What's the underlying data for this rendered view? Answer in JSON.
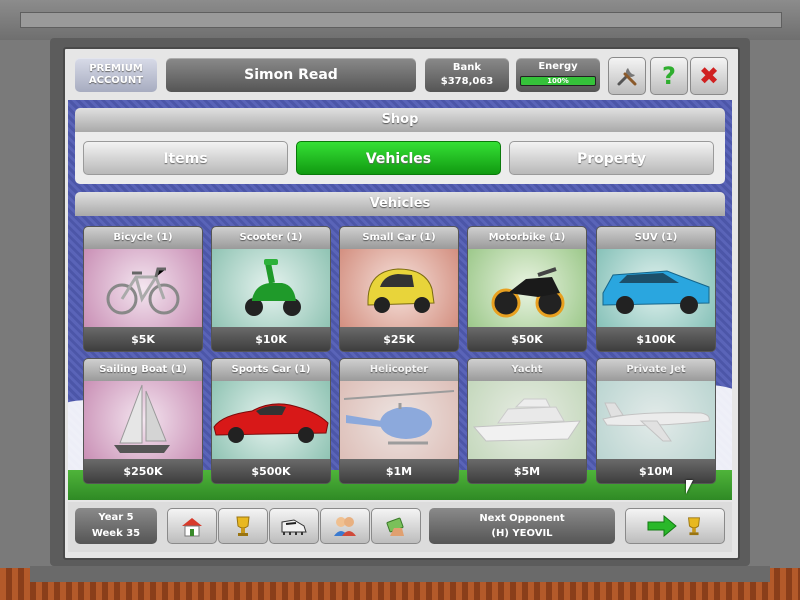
{
  "header": {
    "account_type": "PREMIUM ACCOUNT",
    "manager_name": "Simon Read",
    "bank_label": "Bank",
    "bank_value": "$378,063",
    "energy_label": "Energy",
    "energy_value": "100%",
    "energy_fraction": 1.0
  },
  "shop": {
    "title": "Shop",
    "tabs": [
      {
        "label": "Items",
        "active": false
      },
      {
        "label": "Vehicles",
        "active": true
      },
      {
        "label": "Property",
        "active": false
      }
    ]
  },
  "vehicles": {
    "title": "Vehicles",
    "items": [
      {
        "name": "Bicycle (1)",
        "price": "$5K",
        "owned": true,
        "icon": "bicycle-icon"
      },
      {
        "name": "Scooter (1)",
        "price": "$10K",
        "owned": true,
        "icon": "scooter-icon"
      },
      {
        "name": "Small Car (1)",
        "price": "$25K",
        "owned": true,
        "icon": "small-car-icon"
      },
      {
        "name": "Motorbike (1)",
        "price": "$50K",
        "owned": true,
        "icon": "motorbike-icon"
      },
      {
        "name": "SUV (1)",
        "price": "$100K",
        "owned": true,
        "icon": "suv-icon"
      },
      {
        "name": "Sailing Boat (1)",
        "price": "$250K",
        "owned": true,
        "icon": "sailing-boat-icon"
      },
      {
        "name": "Sports Car (1)",
        "price": "$500K",
        "owned": true,
        "icon": "sports-car-icon"
      },
      {
        "name": "Helicopter",
        "price": "$1M",
        "owned": false,
        "icon": "helicopter-icon"
      },
      {
        "name": "Yacht",
        "price": "$5M",
        "owned": false,
        "icon": "yacht-icon"
      },
      {
        "name": "Private Jet",
        "price": "$10M",
        "owned": false,
        "icon": "private-jet-icon"
      }
    ]
  },
  "footer": {
    "year": "Year 5",
    "week": "Week 35",
    "next_opponent_label": "Next Opponent",
    "next_opponent": "(H) YEOVIL"
  },
  "colors": {
    "active_tab": "#1fbf1f",
    "background_pattern": "#4c56a8",
    "close_red": "#d02020",
    "help_green": "#2fae2f"
  }
}
